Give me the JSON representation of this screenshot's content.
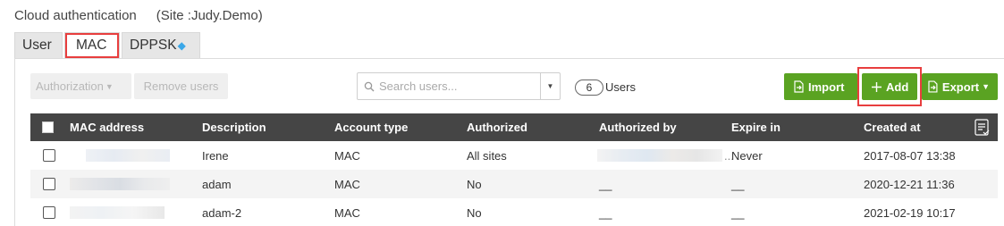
{
  "header": {
    "title": "Cloud authentication",
    "site": "(Site :Judy.Demo)"
  },
  "tabs": [
    {
      "label": "User"
    },
    {
      "label": "MAC"
    },
    {
      "label": "DPPSK",
      "icon": "diamond-icon"
    }
  ],
  "toolbar": {
    "authorization_label": "Authorization",
    "remove_label": "Remove users",
    "search_placeholder": "Search users...",
    "user_count": "6",
    "user_count_label": "Users",
    "import_label": "Import",
    "add_label": "Add",
    "export_label": "Export"
  },
  "table": {
    "columns": [
      "MAC address",
      "Description",
      "Account type",
      "Authorized",
      "Authorized by",
      "Expire in",
      "Created at"
    ],
    "rows": [
      {
        "description": "Irene",
        "account_type": "MAC",
        "authorized": "All sites",
        "authorized_by_suffix": "...",
        "expire_in": "Never",
        "created_at": "2017-08-07 13:38"
      },
      {
        "description": "adam",
        "account_type": "MAC",
        "authorized": "No",
        "authorized_by": "__",
        "expire_in": "__",
        "created_at": "2020-12-21 11:36"
      },
      {
        "description": "adam-2",
        "account_type": "MAC",
        "authorized": "No",
        "authorized_by": "__",
        "expire_in": "__",
        "created_at": "2021-02-19 10:17"
      }
    ]
  },
  "colors": {
    "accent_green": "#5aa322",
    "header_dark": "#454545",
    "highlight_red": "#e83e3e"
  }
}
